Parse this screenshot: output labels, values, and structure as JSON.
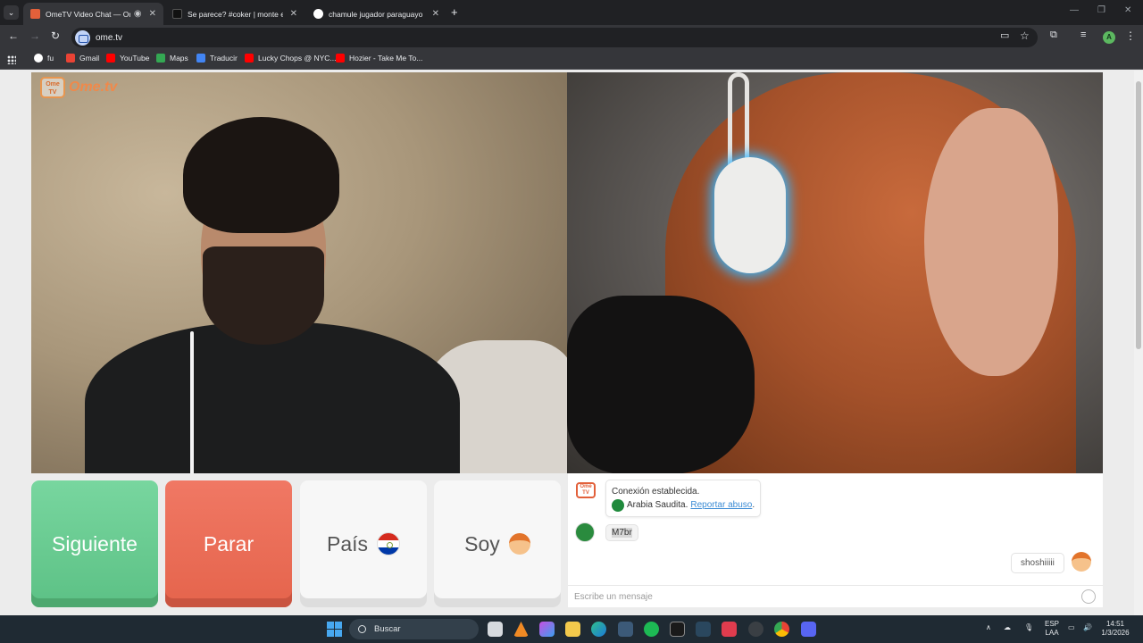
{
  "browser": {
    "tabs": [
      {
        "title": "OmeTV Video Chat — Om",
        "active": true,
        "favicon_color": "#e2603a"
      },
      {
        "title": "Se parece? #coker | monte evere",
        "active": false,
        "favicon_color": "#111111"
      },
      {
        "title": "chamule jugador paraguayo - B",
        "active": false,
        "favicon_color": "#ffffff"
      }
    ],
    "new_tab": "+",
    "url": "ome.tv",
    "profile_initial": "A",
    "bookmarks": [
      {
        "label": "fu",
        "icon": "google-icon"
      },
      {
        "label": "Gmail",
        "icon": "gmail-icon"
      },
      {
        "label": "YouTube",
        "icon": "youtube-icon"
      },
      {
        "label": "Maps",
        "icon": "maps-icon"
      },
      {
        "label": "Traducir",
        "icon": "translate-icon"
      },
      {
        "label": "Lucky Chops @ NYC...",
        "icon": "youtube-icon"
      },
      {
        "label": "Hozier - Take Me To...",
        "icon": "youtube-icon"
      }
    ]
  },
  "ometv": {
    "logo_tv": "Ome TV",
    "logo_text": "Ome.tv",
    "buttons": {
      "next": "Siguiente",
      "stop": "Parar",
      "country": "País",
      "soy": "Soy"
    },
    "chat": {
      "system_icon_text": "Ome TV",
      "connection_text": "Conexión establecida.",
      "country_text": "Arabia Saudita.",
      "report_link": "Reportar abuso",
      "report_suffix": ".",
      "stranger_message": "M7br",
      "my_message": "shoshiiiii",
      "input_placeholder": "Escribe un mensaje"
    },
    "colors": {
      "next": "#5cc185",
      "stop": "#e5644c",
      "brand": "#f0894a"
    }
  },
  "taskbar": {
    "search_label": "Buscar",
    "language": "ESP",
    "language_sub": "LAA",
    "time": "14:51",
    "date": "1/3/2026"
  }
}
